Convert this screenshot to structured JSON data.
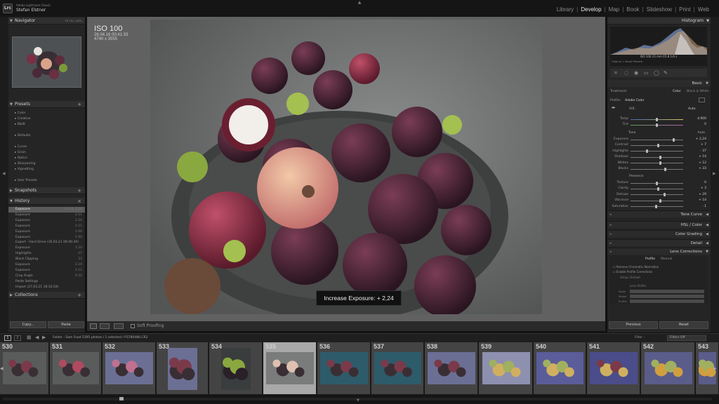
{
  "app": {
    "product": "Adobe Lightroom Classic",
    "user": "Stefan Elstner",
    "logo": "Lrc"
  },
  "modules": [
    "Library",
    "Develop",
    "Map",
    "Book",
    "Slideshow",
    "Print",
    "Web"
  ],
  "active_module": "Develop",
  "navigator": {
    "title": "Navigator",
    "zoom": [
      "FIT",
      "FILL",
      "100%",
      "100%"
    ]
  },
  "presets": {
    "title": "Presets",
    "items": [
      "Color",
      "Creative",
      "B&W",
      "Defaults",
      "Curve",
      "Grain",
      "Optics",
      "Sharpening",
      "Vignetting",
      "User Presets"
    ]
  },
  "snapshots": {
    "title": "Snapshots"
  },
  "history": {
    "title": "History",
    "items": [
      {
        "label": "Exposure",
        "v1": "+2.11",
        "v2": "2.24"
      },
      {
        "label": "Exposure",
        "v1": "",
        "v2": "2.11"
      },
      {
        "label": "Exposure",
        "v1": "",
        "v2": "2.24"
      },
      {
        "label": "Exposure",
        "v1": "",
        "v2": "2.11"
      },
      {
        "label": "Exposure",
        "v1": "",
        "v2": "2.00"
      },
      {
        "label": "Exposure",
        "v1": "",
        "v2": "1.90"
      },
      {
        "label": "Export - Hard Drive (16.03.21 09:46:30)",
        "v1": "",
        "v2": ""
      },
      {
        "label": "Exposure",
        "v1": "",
        "v2": "2.24"
      },
      {
        "label": "Highlights",
        "v1": "",
        "v2": "-37"
      },
      {
        "label": "Black Clipping",
        "v1": "",
        "v2": "33"
      },
      {
        "label": "Exposure",
        "v1": "",
        "v2": "2.24"
      },
      {
        "label": "Exposure",
        "v1": "",
        "v2": "2.11"
      },
      {
        "label": "Crop Angle",
        "v1": "",
        "v2": "0.52"
      },
      {
        "label": "Paste Settings",
        "v1": "",
        "v2": ""
      },
      {
        "label": "Import (27.03.21 18:32:54)",
        "v1": "",
        "v2": ""
      }
    ]
  },
  "collections": {
    "title": "Collections"
  },
  "left_buttons": {
    "copy": "Copy...",
    "paste": "Paste"
  },
  "photo_info": {
    "iso": "ISO 100",
    "date": "26.04.16 00:41:33",
    "dims": "4740 x 3555"
  },
  "tooltip": "Increase Exposure: + 2,24",
  "toolbar": {
    "soft_proofing": "Soft Proofing"
  },
  "histogram": {
    "title": "Histogram",
    "readout": "ISO 100   23 mm   f/2.8   1/4 s",
    "preview": "Original + Smart Preview"
  },
  "basic": {
    "title": "Basic",
    "treatment_label": "Treatment:",
    "color": "Color",
    "bw": "Black & White",
    "profile_label": "Profile:",
    "profile": "Adobe Color",
    "wb_label": "WB:",
    "wb": "Auto",
    "temp": {
      "label": "Temp",
      "value": "4.900"
    },
    "tint": {
      "label": "Tint",
      "value": "0"
    },
    "tone_label": "Tone",
    "tone_auto": "Auto",
    "sliders": [
      {
        "label": "Exposure",
        "value": "+ 2,24",
        "pos": 0.82
      },
      {
        "label": "Contrast",
        "value": "+ 7",
        "pos": 0.53
      },
      {
        "label": "Highlights",
        "value": "- 37",
        "pos": 0.31
      },
      {
        "label": "Shadows",
        "value": "+ 14",
        "pos": 0.57
      },
      {
        "label": "Whites",
        "value": "+ 12",
        "pos": 0.56
      },
      {
        "label": "Blacks",
        "value": "+ 33",
        "pos": 0.66
      }
    ],
    "presence_label": "Presence",
    "presence": [
      {
        "label": "Texture",
        "value": "0",
        "pos": 0.5
      },
      {
        "label": "Clarity",
        "value": "+ 3",
        "pos": 0.52
      },
      {
        "label": "Dehaze",
        "value": "+ 29",
        "pos": 0.64
      },
      {
        "label": "Vibrance",
        "value": "+ 14",
        "pos": 0.57
      },
      {
        "label": "Saturation",
        "value": "- 1",
        "pos": 0.49
      }
    ]
  },
  "right_sections": [
    "Tone Curve",
    "HSL / Color",
    "Color Grading",
    "Detail",
    "Lens Corrections"
  ],
  "lens": {
    "tabs": [
      "Profile",
      "Manual"
    ],
    "checks": [
      "Remove Chromatic Aberration",
      "Enable Profile Corrections"
    ],
    "setup_label": "Setup",
    "setup": "Default",
    "profile_label": "Lens Profile",
    "rows": [
      "Make",
      "Model",
      "Profile"
    ],
    "amount": "Amount"
  },
  "right_buttons": {
    "previous": "Previous",
    "reset": "Reset"
  },
  "filmstrip": {
    "info": "Folder : Sam Food     5395 photos / 1 selected / P3780486.CR2",
    "filter_label": "Filter :",
    "filter": "Filters Off",
    "frames": [
      "530",
      "531",
      "532",
      "533",
      "534",
      "535",
      "536",
      "537",
      "538",
      "539",
      "540",
      "541",
      "542",
      "543"
    ],
    "selected": "535"
  },
  "colors": {
    "accent": "#e6e6e6",
    "panel": "#252525",
    "center": "#616161"
  }
}
